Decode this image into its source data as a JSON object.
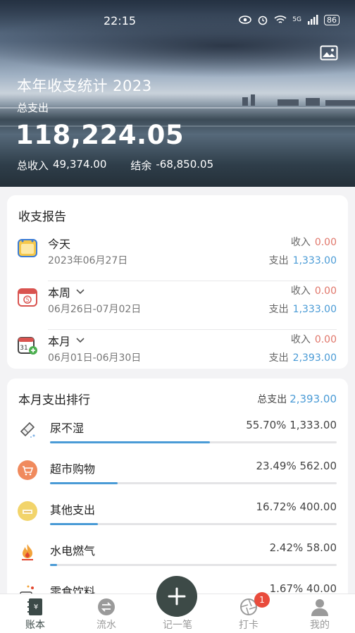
{
  "status": {
    "time": "22:15",
    "battery": "86",
    "signal_label": "5G"
  },
  "header": {
    "title": "本年收支统计 2023",
    "expense_label": "总支出",
    "expense_total": "118,224.05",
    "income_label": "总收入",
    "income_total": "49,374.00",
    "balance_label": "结余",
    "balance_total": "-68,850.05"
  },
  "report": {
    "title": "收支报告",
    "income_label": "收入",
    "expense_label": "支出",
    "rows": [
      {
        "name": "今天",
        "date": "2023年06月27日",
        "income": "0.00",
        "expense": "1,333.00",
        "has_dropdown": false
      },
      {
        "name": "本周",
        "date": "06月26日-07月02日",
        "income": "0.00",
        "expense": "1,333.00",
        "has_dropdown": true
      },
      {
        "name": "本月",
        "date": "06月01日-06月30日",
        "income": "0.00",
        "expense": "2,393.00",
        "has_dropdown": true
      }
    ]
  },
  "ranking": {
    "title": "本月支出排行",
    "total_label": "总支出",
    "total_value": "2,393.00",
    "items": [
      {
        "name": "尿不湿",
        "percent": "55.70%",
        "amount": "1,333.00",
        "share": 0.557,
        "icon": "diaper-icon",
        "color": "#ffffff"
      },
      {
        "name": "超市购物",
        "percent": "23.49%",
        "amount": "562.00",
        "share": 0.2349,
        "icon": "shopping-cart-icon",
        "color": "#f08a5d"
      },
      {
        "name": "其他支出",
        "percent": "16.72%",
        "amount": "400.00",
        "share": 0.1672,
        "icon": "other-expense-icon",
        "color": "#f2d46b"
      },
      {
        "name": "水电燃气",
        "percent": "2.42%",
        "amount": "58.00",
        "share": 0.0242,
        "icon": "fire-icon",
        "color": "#ffffff"
      },
      {
        "name": "零食饮料",
        "percent": "1.67%",
        "amount": "40.00",
        "share": 0.0167,
        "icon": "snack-icon",
        "color": "#ffffff"
      }
    ]
  },
  "tabbar": {
    "items": [
      {
        "label": "账本",
        "icon": "ledger-icon",
        "active": true
      },
      {
        "label": "流水",
        "icon": "transfer-icon",
        "active": false
      },
      {
        "label": "记一笔",
        "icon": "plus-icon",
        "active": false
      },
      {
        "label": "打卡",
        "icon": "camera-aperture-icon",
        "active": false,
        "badge": "1"
      },
      {
        "label": "我的",
        "icon": "profile-icon",
        "active": false
      }
    ]
  },
  "colors": {
    "accent_blue": "#4a9bd6",
    "income_red": "#e0766a",
    "fab": "#3d4a47"
  }
}
